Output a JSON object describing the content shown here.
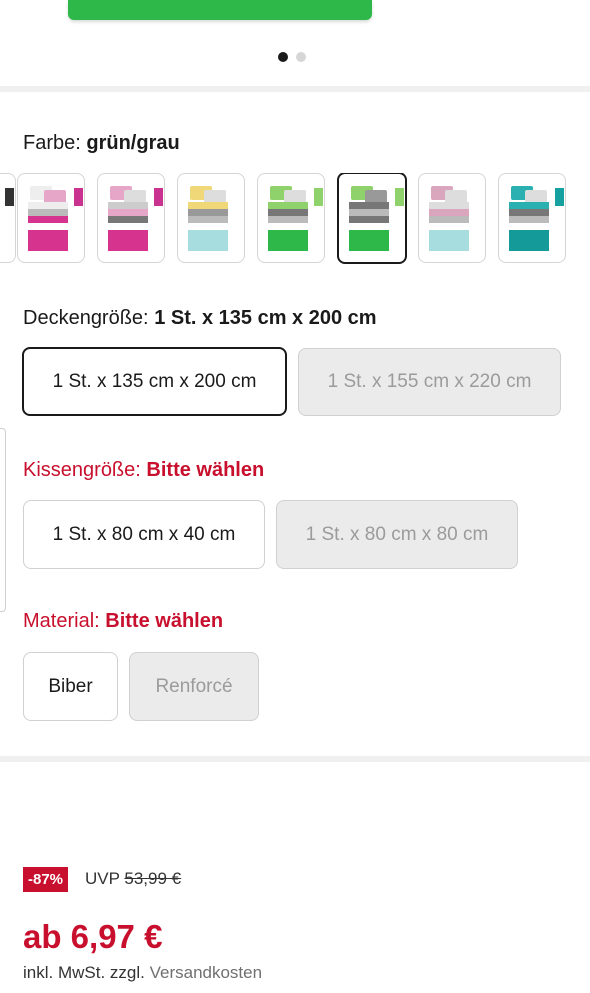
{
  "carousel": {
    "dots": 2,
    "active": 0
  },
  "color": {
    "label": "Farbe:",
    "value": "grün/grau"
  },
  "swatches": [
    {
      "accent": "#333333",
      "bottom": "#cccccc"
    },
    {
      "accent": "#c9338f",
      "bottom": "#d6338f"
    },
    {
      "accent": "#c9338f",
      "bottom": "#d6338f"
    },
    {
      "accent": "#f0d878",
      "bottom": "#a8dde0"
    },
    {
      "accent": "#8fd16a",
      "bottom": "#2fb84a"
    },
    {
      "accent": "#8fd16a",
      "bottom": "#2fb84a"
    },
    {
      "accent": "#d9a6bd",
      "bottom": "#a8dde0"
    },
    {
      "accent": "#2ab0b0",
      "bottom": "#159a9a"
    },
    {
      "accent": "#16a0a0",
      "bottom": "#16a0a0"
    }
  ],
  "selected_swatch": 5,
  "duvet_size": {
    "label": "Deckengröße:",
    "value": "1 St. x 135 cm x 200 cm",
    "options": [
      "1 St. x 135 cm x 200 cm",
      "1 St. x 155 cm x 220 cm"
    ]
  },
  "pillow_size": {
    "label": "Kissengröße:",
    "value": "Bitte wählen",
    "options": [
      "1 St. x 80 cm x 40 cm",
      "1 St. x 80 cm x 80 cm"
    ]
  },
  "material": {
    "label": "Material:",
    "value": "Bitte wählen",
    "options": [
      "Biber",
      "Renforcé"
    ]
  },
  "pricing": {
    "discount": "-87%",
    "uvp_label": "UVP",
    "uvp_price": "53,99 €",
    "price": "ab 6,97 €",
    "tax_note": "inkl. MwSt. zzgl.",
    "shipping_link": "Versandkosten"
  },
  "colors": {
    "accent_red": "#c8102e"
  }
}
